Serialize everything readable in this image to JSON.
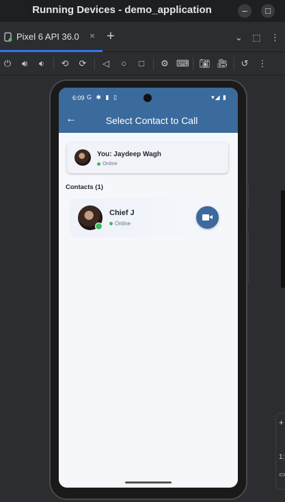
{
  "window": {
    "title": "Running Devices - demo_application",
    "minimize_label": "–",
    "maximize_label": "□"
  },
  "tabs": [
    {
      "label": "Pixel 6 API 36.0",
      "close": "×"
    }
  ],
  "tabbar": {
    "add": "+"
  },
  "phone": {
    "status_time": "6:09",
    "status_icons": "G ✱ ▮ ▯",
    "status_right": "▾◢ ▮",
    "appbar_title": "Select Contact to Call",
    "back_icon": "←",
    "me": {
      "name": "You: Jaydeep Wagh",
      "status": "Online"
    },
    "contacts_header": "Contacts (1)",
    "contacts": [
      {
        "name": "Chief J",
        "status": "Online"
      }
    ]
  },
  "edge_panel": {
    "plus": "+",
    "ratio": "1:"
  },
  "colors": {
    "primary": "#3b6a9c",
    "online": "#3dbb5a",
    "tab_accent": "#3574f0"
  }
}
